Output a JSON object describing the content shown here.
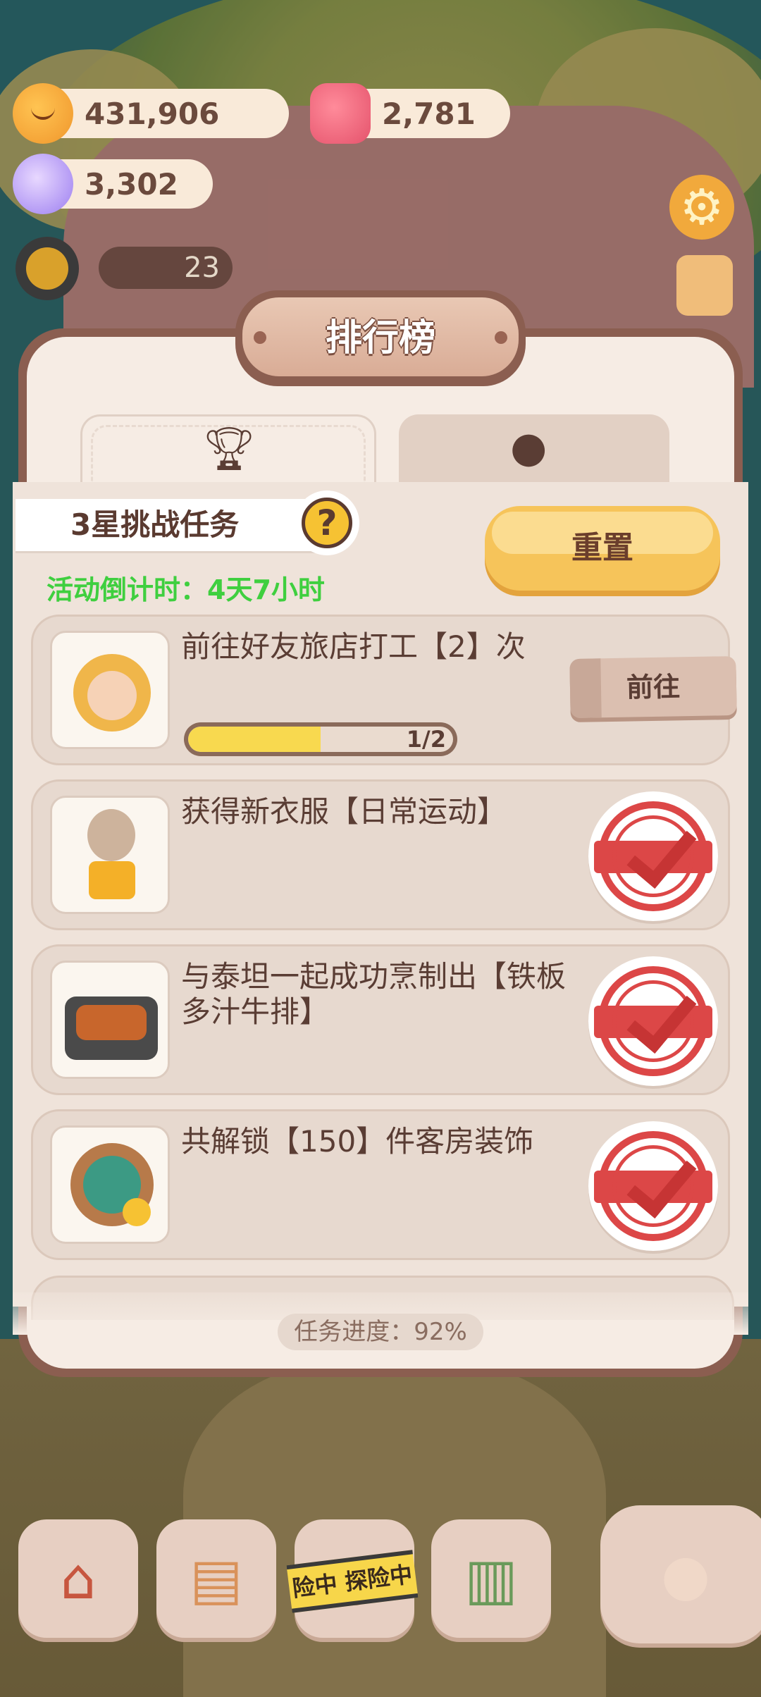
{
  "currencies": {
    "cookies": "431,906",
    "candles": "2,781",
    "gems": "3,302"
  },
  "hud": {
    "level_badge": "23"
  },
  "panel": {
    "title": "排行榜",
    "tabs": [
      {
        "icon": "trophy-icon"
      },
      {
        "icon": "cookie-icon"
      }
    ],
    "challenge_label": "3星挑战任务",
    "help_label": "?",
    "countdown": "活动倒计时：4天7小时",
    "reset_label": "重置",
    "tasks": [
      {
        "title": "前往好友旅店打工【2】次",
        "progress_fraction": 0.5,
        "progress_text": "1/2",
        "action_label": "前往",
        "completed": false
      },
      {
        "title": "获得新衣服【日常运动】",
        "completed": true
      },
      {
        "title": "与泰坦一起成功烹制出【铁板多汁牛排】",
        "completed": true
      },
      {
        "title": "共解锁【150】件客房装饰",
        "completed": true
      }
    ],
    "task_progress": "任务进度：92%"
  },
  "bottom_nav": {
    "adventure_tape": "险中 探险中"
  },
  "colors": {
    "panel_border": "#8b5e50",
    "panel_bg": "#f6ece4",
    "countdown": "#3fcf3f",
    "reset_button": "#f6c45a",
    "progress_fill": "#f8d94f",
    "stamp_red": "#dc4747"
  }
}
